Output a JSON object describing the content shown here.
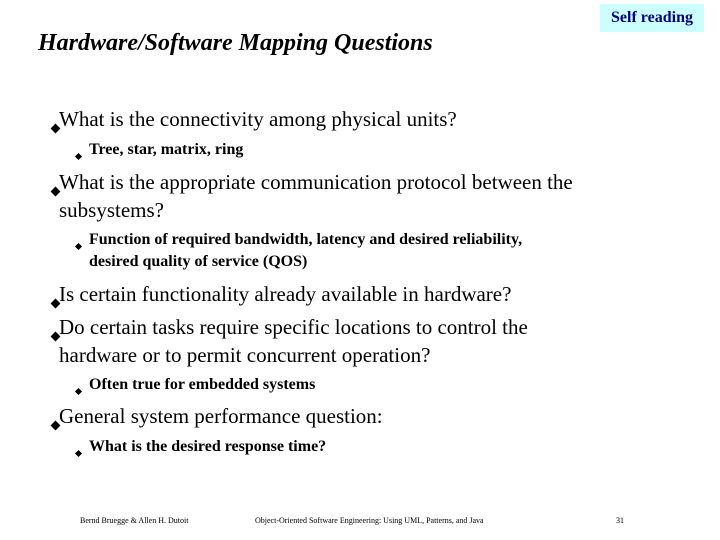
{
  "badge": {
    "label": "Self reading",
    "background": "#ccffff",
    "text_color": "#000080"
  },
  "title": "Hardware/Software Mapping Questions",
  "bullets": [
    {
      "text": "What is the connectivity among physical units?",
      "sub": [
        "Tree, star, matrix, ring"
      ]
    },
    {
      "text_lines": [
        "What is the appropriate communication protocol between the",
        "subsystems?"
      ],
      "sub_lines": [
        "Function of required bandwidth, latency and desired reliability,",
        "desired quality of service (QOS)"
      ]
    },
    {
      "text": "Is certain functionality already available in hardware?"
    },
    {
      "text_lines": [
        "Do certain tasks require specific locations to control the",
        "hardware or to permit concurrent operation?"
      ],
      "sub": [
        "Often true for embedded systems"
      ]
    },
    {
      "text": "General system performance question:",
      "sub": [
        "What is the desired response time?"
      ]
    }
  ],
  "footer": {
    "authors": "Bernd Bruegge & Allen H. Dutoit",
    "book": "Object-Oriented Software Engineering: Using UML, Patterns, and Java",
    "page": "31"
  }
}
